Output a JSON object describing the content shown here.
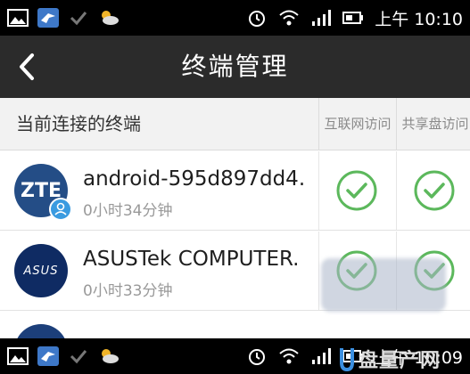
{
  "status_bar_top": {
    "time": "上午 10:10",
    "left_icons": [
      "gallery-icon",
      "bird-app-icon",
      "check-icon",
      "weather-icon"
    ],
    "right_icons": [
      "alarm-icon",
      "wifi-icon",
      "signal-icon",
      "battery-icon"
    ]
  },
  "status_bar_bottom": {
    "time": "上午 10:09",
    "left_icons": [
      "gallery-icon",
      "bird-app-icon",
      "check-icon",
      "weather-icon"
    ],
    "right_icons": [
      "alarm-icon",
      "wifi-icon",
      "signal-icon",
      "battery-icon"
    ]
  },
  "header": {
    "title": "终端管理",
    "back_icon": "back-arrow-icon"
  },
  "list_header": {
    "label": "当前连接的终端",
    "col_internet": "互联网访问",
    "col_share": "共享盘访问"
  },
  "devices": [
    {
      "avatar_text": "ZTE",
      "name": "android-595d897dd4.",
      "duration": "0小时34分钟",
      "internet": true,
      "share": true,
      "badge": "user-icon"
    },
    {
      "avatar_text": "ASUS",
      "name": "ASUSTek COMPUTER.",
      "duration": "0小时33分钟",
      "internet": true,
      "share": true
    }
  ],
  "watermark": {
    "text": "盘量产网"
  },
  "colors": {
    "titlebar": "#2b2b2b",
    "check_green": "#4caf50",
    "header_bg": "#f2f2f2"
  }
}
